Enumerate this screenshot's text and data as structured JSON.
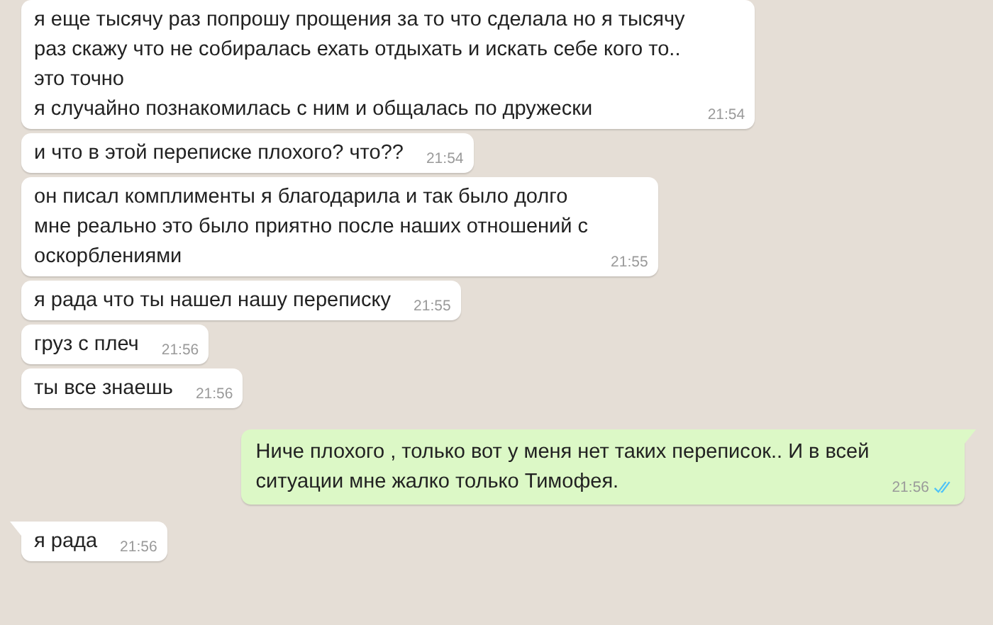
{
  "messages": [
    {
      "outgoing": false,
      "tail": false,
      "text": "я еще тысячу раз попрошу прощения за то что сделала но я тысячу\nраз скажу что не собиралась ехать отдыхать и искать себе кого то..\nэто точно\nя случайно познакомилась с ним и общалась по дружески\n",
      "time": "21:54"
    },
    {
      "outgoing": false,
      "tail": false,
      "text": "и что в этой переписке плохого? что??",
      "time": "21:54"
    },
    {
      "outgoing": false,
      "tail": false,
      "text": "он писал комплименты я благодарила и так было долго\nмне реально это было приятно после наших отношений с\nоскорблениями",
      "time": "21:55"
    },
    {
      "outgoing": false,
      "tail": false,
      "text": "я рада что ты нашел нашу переписку",
      "time": "21:55"
    },
    {
      "outgoing": false,
      "tail": false,
      "text": "груз с плеч",
      "time": "21:56"
    },
    {
      "outgoing": false,
      "tail": false,
      "text": "ты все знаешь",
      "time": "21:56"
    },
    {
      "outgoing": true,
      "tail": true,
      "text": "Ниче плохого , только вот у меня нет таких переписок.. И в всей\nситуации мне жалко только Тимофея.",
      "time": "21:56",
      "read": true
    },
    {
      "outgoing": false,
      "tail": true,
      "text": "я рада",
      "time": "21:56"
    }
  ]
}
